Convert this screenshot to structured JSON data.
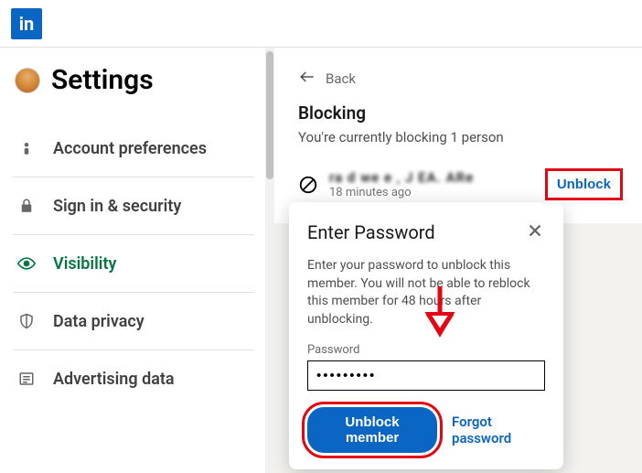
{
  "header": {
    "logo_text": "in"
  },
  "sidebar": {
    "title": "Settings",
    "items": [
      {
        "label": "Account preferences"
      },
      {
        "label": "Sign in & security"
      },
      {
        "label": "Visibility"
      },
      {
        "label": "Data privacy"
      },
      {
        "label": "Advertising data"
      }
    ]
  },
  "main": {
    "back_label": "Back",
    "title": "Blocking",
    "subtitle": "You're currently blocking 1 person",
    "blocked": {
      "name": "ra d we e , J EA. ARe",
      "time": "18 minutes ago",
      "unblock_label": "Unblock"
    }
  },
  "modal": {
    "title": "Enter Password",
    "body": "Enter your password to unblock this member. You will not be able to reblock this member for 48 hours after unblocking.",
    "field_label": "Password",
    "password_value": "•••••••••",
    "primary": "Unblock member",
    "forgot": "Forgot password"
  }
}
